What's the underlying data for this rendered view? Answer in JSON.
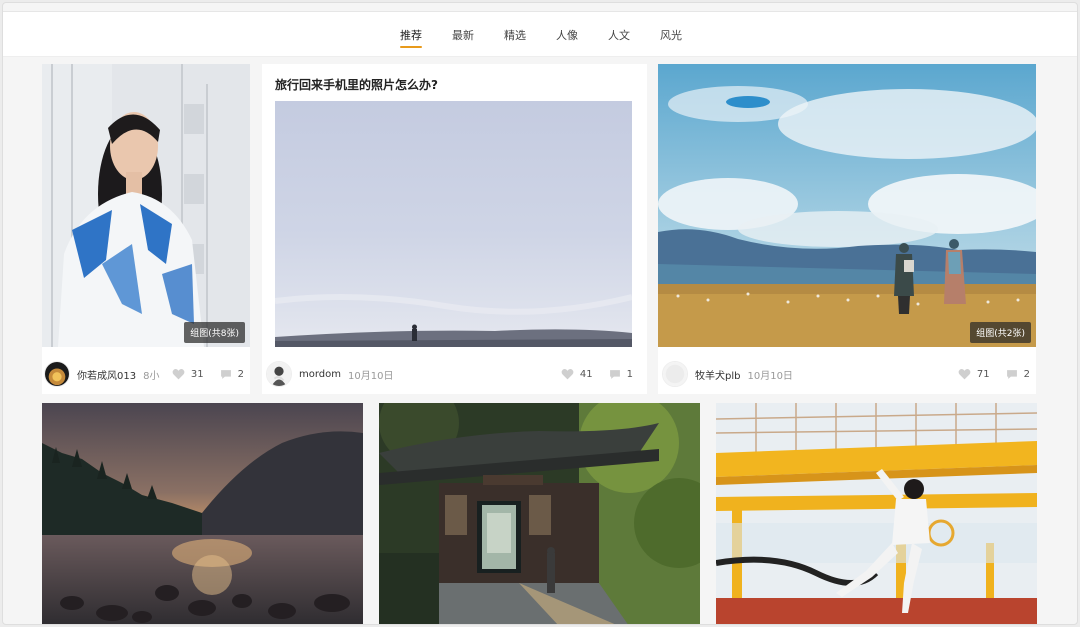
{
  "tabs": [
    {
      "label": "推荐",
      "active": true
    },
    {
      "label": "最新",
      "active": false
    },
    {
      "label": "精选",
      "active": false
    },
    {
      "label": "人像",
      "active": false
    },
    {
      "label": "人文",
      "active": false
    },
    {
      "label": "风光",
      "active": false
    }
  ],
  "cards": [
    {
      "title": "",
      "badge": "组图(共8张)",
      "author": "你若成风013",
      "date": "8小",
      "likes": "31",
      "comments": "2"
    },
    {
      "title": "旅行回来手机里的照片怎么办?",
      "badge": "",
      "author": "mordom",
      "date": "10月10日",
      "likes": "41",
      "comments": "1"
    },
    {
      "title": "",
      "badge": "组图(共2张)",
      "author": "牧羊犬plb",
      "date": "10月10日",
      "likes": "71",
      "comments": "2"
    }
  ],
  "colors": {
    "accent": "#e89a1b",
    "background": "#f5f5f5",
    "card": "#ffffff"
  },
  "icons": [
    "heart-icon",
    "comment-icon"
  ]
}
